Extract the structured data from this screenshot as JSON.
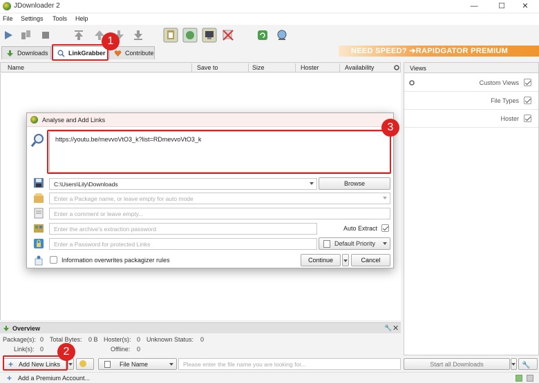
{
  "window": {
    "title": "JDownloader 2",
    "minimize": "—",
    "maximize": "☐",
    "close": "✕"
  },
  "menu": [
    "File",
    "Settings",
    "Tools",
    "Help"
  ],
  "tabs": {
    "downloads": "Downloads",
    "linkgrabber": "LinkGrabber",
    "contribute": "Contribute"
  },
  "banner": "NEED SPEED? ➔RAPIDGATOR PREMIUM",
  "columns": {
    "name": "Name",
    "save_to": "Save to",
    "size": "Size",
    "hoster": "Hoster",
    "availability": "Availability"
  },
  "views": {
    "title": "Views",
    "items": [
      {
        "label": "Custom Views",
        "checked": true
      },
      {
        "label": "File Types",
        "checked": true
      },
      {
        "label": "Hoster",
        "checked": true
      }
    ]
  },
  "overview": {
    "title": "Overview",
    "packages_label": "Package(s):",
    "packages": "0",
    "total_bytes_label": "Total Bytes:",
    "total_bytes": "0 B",
    "hosters_label": "Hoster(s):",
    "hosters": "0",
    "unknown_label": "Unknown Status:",
    "unknown": "0",
    "links_label": "Link(s):",
    "links": "0",
    "offline_label": "Offline:",
    "offline": "0"
  },
  "bottom": {
    "add_links": "Add New Links",
    "filter_column": "File Name",
    "search_placeholder": "Please enter the file name you are looking for...",
    "start_all": "Start all Downloads"
  },
  "status": {
    "premium": "Add a Premium Account..."
  },
  "dialog": {
    "title": "Analyse and Add Links",
    "url": "https://youtu.be/mevvoVtO3_k?list=RDmevvoVtO3_k",
    "folder": "C:\\Users\\Lily\\Downloads",
    "browse": "Browse",
    "package_placeholder": "Enter a Package name, or leave empty for auto mode",
    "comment_placeholder": "Enter a comment or leave empty...",
    "archive_placeholder": "Enter the archive's extraction password",
    "auto_extract": "Auto Extract",
    "link_password_placeholder": "Enter a Password for protected Links",
    "priority": "Default Priority",
    "overwrite_label": "Information overwrites packagizer rules",
    "continue": "Continue",
    "cancel": "Cancel"
  },
  "annotations": {
    "one": "1",
    "two": "2",
    "three": "3"
  },
  "colors": {
    "highlight": "#d22222",
    "banner": "#f0952e",
    "dialog_title_bg": "#fbefee"
  }
}
